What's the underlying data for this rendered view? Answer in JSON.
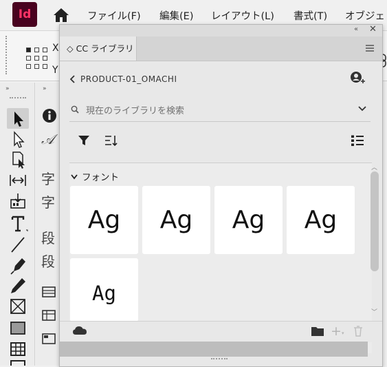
{
  "app": {
    "logo_text": "Id",
    "accent": "#ff3366",
    "logo_bg": "#49021f"
  },
  "menu": {
    "items": [
      "ファイル(F)",
      "編集(E)",
      "レイアウト(L)",
      "書式(T)",
      "オブジェ"
    ]
  },
  "control": {
    "x_label": "X",
    "y_label": "Y"
  },
  "panel": {
    "tab_label": "◇ CC ライブラリ",
    "library_name": "PRODUCT-01_OMACHI",
    "search_placeholder": "現在のライブラリを検索",
    "section_label": "フォント",
    "font_samples": [
      "Ag",
      "Ag",
      "Ag",
      "Ag",
      "Ag"
    ]
  }
}
